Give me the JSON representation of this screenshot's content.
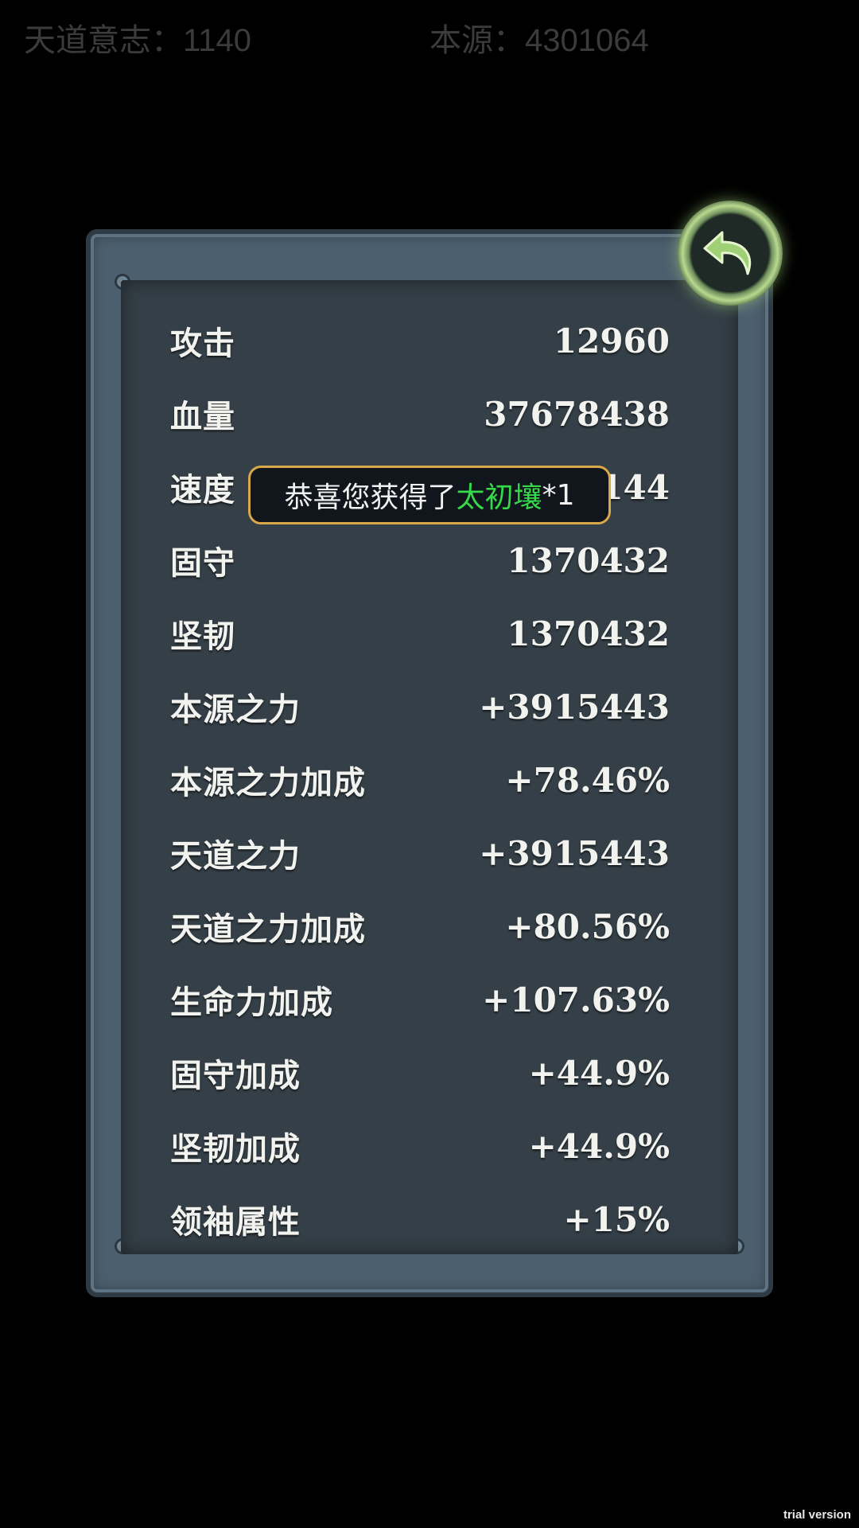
{
  "top_bar": {
    "tiandao_will": "天道意志：1140",
    "origin": "本源：4301064"
  },
  "stats": [
    {
      "label": "攻击",
      "value": "12960"
    },
    {
      "label": "血量",
      "value": "37678438"
    },
    {
      "label": "速度",
      "value": "144"
    },
    {
      "label": "固守",
      "value": "1370432"
    },
    {
      "label": "坚韧",
      "value": "1370432"
    },
    {
      "label": "本源之力",
      "value": "+3915443"
    },
    {
      "label": "本源之力加成",
      "value": "+78.46%"
    },
    {
      "label": "天道之力",
      "value": "+3915443"
    },
    {
      "label": "天道之力加成",
      "value": "+80.56%"
    },
    {
      "label": "生命力加成",
      "value": "+107.63%"
    },
    {
      "label": "固守加成",
      "value": "+44.9%"
    },
    {
      "label": "坚韧加成",
      "value": "+44.9%"
    },
    {
      "label": "领袖属性",
      "value": "+15%"
    }
  ],
  "toast": {
    "prefix": "恭喜您获得了",
    "item_name": "太初壤",
    "suffix": "*1",
    "item_color": "#36d94a"
  },
  "back_button": {
    "icon": "back-arrow-icon"
  },
  "watermark": "trial version"
}
